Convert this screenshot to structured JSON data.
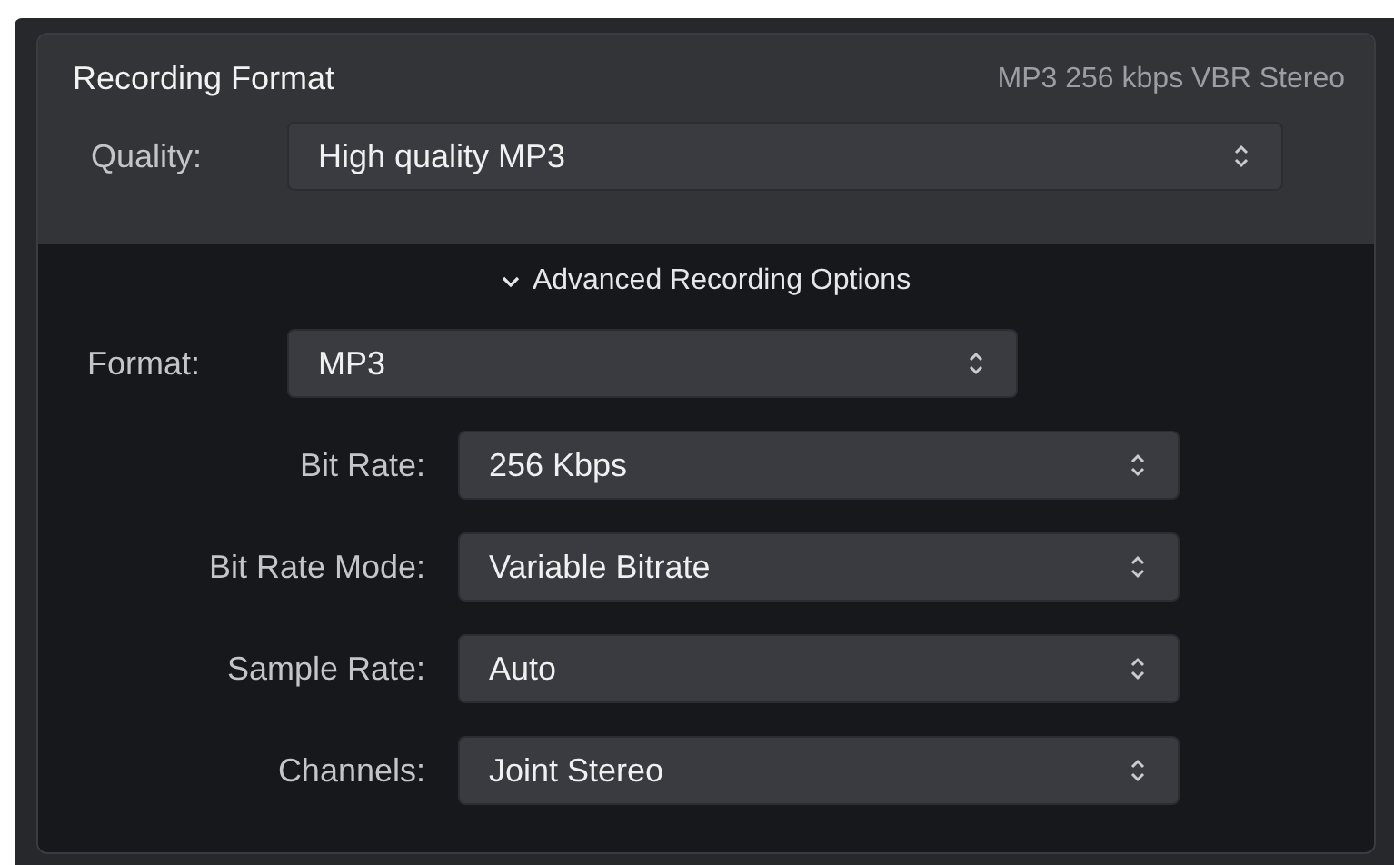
{
  "section": {
    "title": "Recording Format",
    "summary": "MP3 256 kbps VBR Stereo"
  },
  "quality": {
    "label": "Quality:",
    "value": "High quality MP3"
  },
  "advanced": {
    "label": "Advanced Recording Options",
    "expanded": true,
    "format": {
      "label": "Format:",
      "value": "MP3"
    },
    "options": [
      {
        "label": "Bit Rate:",
        "value": "256 Kbps"
      },
      {
        "label": "Bit Rate Mode:",
        "value": "Variable Bitrate"
      },
      {
        "label": "Sample Rate:",
        "value": "Auto"
      },
      {
        "label": "Channels:",
        "value": "Joint Stereo"
      }
    ]
  }
}
